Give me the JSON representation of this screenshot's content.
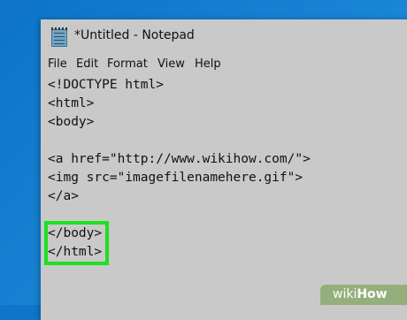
{
  "window": {
    "title": "*Untitled - Notepad",
    "icon": "notepad-icon"
  },
  "menu": [
    {
      "label": "File"
    },
    {
      "label": "Edit"
    },
    {
      "label": "Format"
    },
    {
      "label": "View"
    },
    {
      "label": "Help"
    }
  ],
  "editor": {
    "lines": [
      "<!DOCTYPE html>",
      "<html>",
      "<body>",
      "",
      "<a href=\"http://www.wikihow.com/\">",
      "<img src=\"imagefilenamehere.gif\">",
      "</a>",
      "",
      "</body>",
      "</html>"
    ]
  },
  "highlight_color": "#1fe01f",
  "watermark": {
    "prefix": "wiki",
    "suffix": "How"
  }
}
